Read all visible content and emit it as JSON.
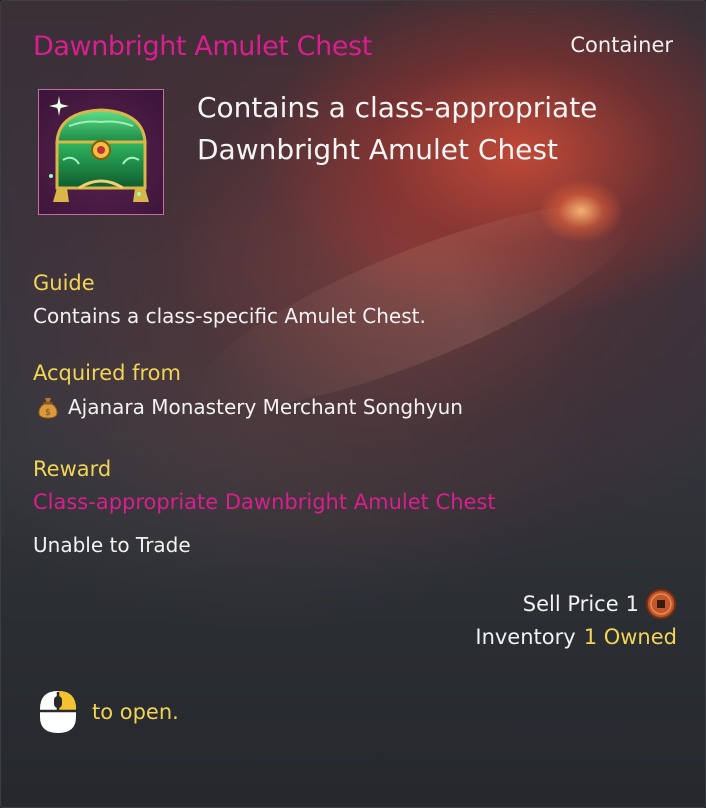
{
  "item": {
    "name": "Dawnbright Amulet Chest",
    "category": "Container",
    "icon": "green-treasure-chest-icon",
    "summary_line1": "Contains a class-appropriate",
    "summary_line2": "Dawnbright Amulet Chest"
  },
  "guide": {
    "heading": "Guide",
    "text": "Contains a class-specific Amulet Chest."
  },
  "acquired": {
    "heading": "Acquired from",
    "icon": "money-bag-icon",
    "source": "Ajanara Monastery Merchant Songhyun"
  },
  "reward": {
    "heading": "Reward",
    "item": "Class-appropriate Dawnbright Amulet Chest",
    "trade": "Unable to Trade"
  },
  "sell": {
    "label": "Sell Price",
    "value": "1",
    "icon": "copper-coin-icon"
  },
  "inventory": {
    "label": "Inventory",
    "owned": "1 Owned"
  },
  "hint": {
    "icon": "mouse-right-click-icon",
    "text": "to open."
  },
  "colors": {
    "item_name": "#d91e8f",
    "section_heading": "#f2d456",
    "body_text": "#f2f2f2",
    "panel_bg": "#2e3035"
  }
}
